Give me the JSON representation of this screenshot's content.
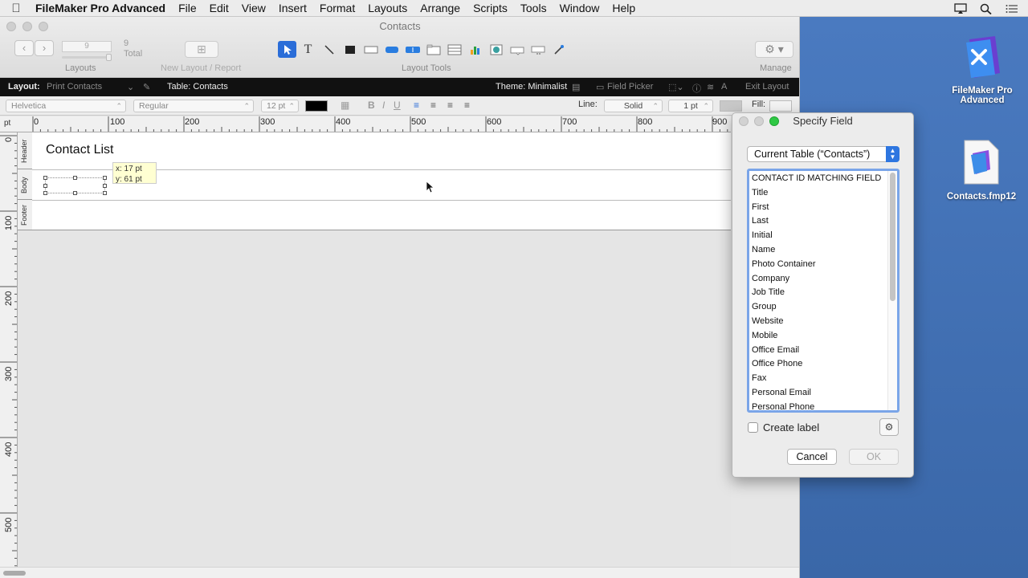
{
  "menubar": {
    "app_name": "FileMaker Pro Advanced",
    "items": [
      "File",
      "Edit",
      "View",
      "Insert",
      "Format",
      "Layouts",
      "Arrange",
      "Scripts",
      "Tools",
      "Window",
      "Help"
    ]
  },
  "window": {
    "title": "Contacts",
    "layout_number": "9",
    "layout_total_count": "9",
    "layout_total_label": "Total",
    "layouts_label": "Layouts",
    "new_layout_label": "New Layout / Report",
    "layout_tools_label": "Layout Tools",
    "manage_label": "Manage"
  },
  "layoutbar": {
    "layout_label": "Layout:",
    "layout_name": "Print Contacts",
    "table_label": "Table: Contacts",
    "theme_label": "Theme: Minimalist",
    "field_picker_label": "Field Picker",
    "exit_layout_label": "Exit Layout"
  },
  "formatbar": {
    "font": "Helvetica",
    "style": "Regular",
    "size": "12 pt",
    "line_label": "Line:",
    "line_style": "Solid",
    "line_width": "1 pt",
    "fill_label": "Fill:"
  },
  "ruler": {
    "unit": "pt",
    "top_ticks": [
      "0",
      "100",
      "200",
      "300",
      "400",
      "500",
      "600",
      "700",
      "800",
      "900"
    ],
    "left_ticks": [
      "0",
      "100",
      "200",
      "300",
      "400",
      "500"
    ]
  },
  "parts": {
    "header": "Header",
    "body": "Body",
    "footer": "Footer"
  },
  "canvas": {
    "title_text": "Contact List",
    "tooltip_x": "x: 17 pt",
    "tooltip_y": "y: 61 pt"
  },
  "dialog": {
    "title": "Specify Field",
    "table_selector": "Current Table (“Contacts”)",
    "fields": [
      "CONTACT ID MATCHING FIELD",
      "Title",
      "First",
      "Last",
      "Initial",
      "Name",
      "Photo Container",
      "Company",
      "Job Title",
      "Group",
      "Website",
      "Mobile",
      "Office Email",
      "Office Phone",
      "Fax",
      "Personal Email",
      "Personal Phone"
    ],
    "create_label": "Create label",
    "cancel": "Cancel",
    "ok": "OK"
  },
  "desktop": {
    "app_icon_label_1": "FileMaker Pro",
    "app_icon_label_2": "Advanced",
    "file_icon_label": "Contacts.fmp12"
  }
}
